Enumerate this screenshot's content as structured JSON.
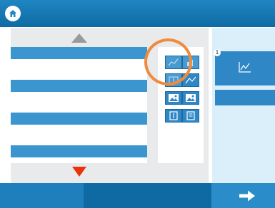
{
  "colors": {
    "header_blue": "#1f86c2",
    "list_stripe_blue": "#3b96cf",
    "tile_blue": "#2f87c6",
    "highlight_orange": "#f08a3c",
    "down_arrow_red": "#e8330c",
    "up_arrow_gray": "#9a9a9a"
  },
  "header": {
    "home_icon": "home-icon"
  },
  "icon_panel": {
    "icons": [
      "line-chart-icon",
      "bar-chart-icon",
      "table-icon",
      "chart-icon",
      "photo-card-icon",
      "photo-card-icon",
      "text-block-icon",
      "text-block-icon"
    ]
  },
  "right_panel": {
    "tile_number": "1",
    "tile_icon": "line-chart-icon"
  },
  "footer": {
    "next_icon": "arrow-right-icon"
  }
}
